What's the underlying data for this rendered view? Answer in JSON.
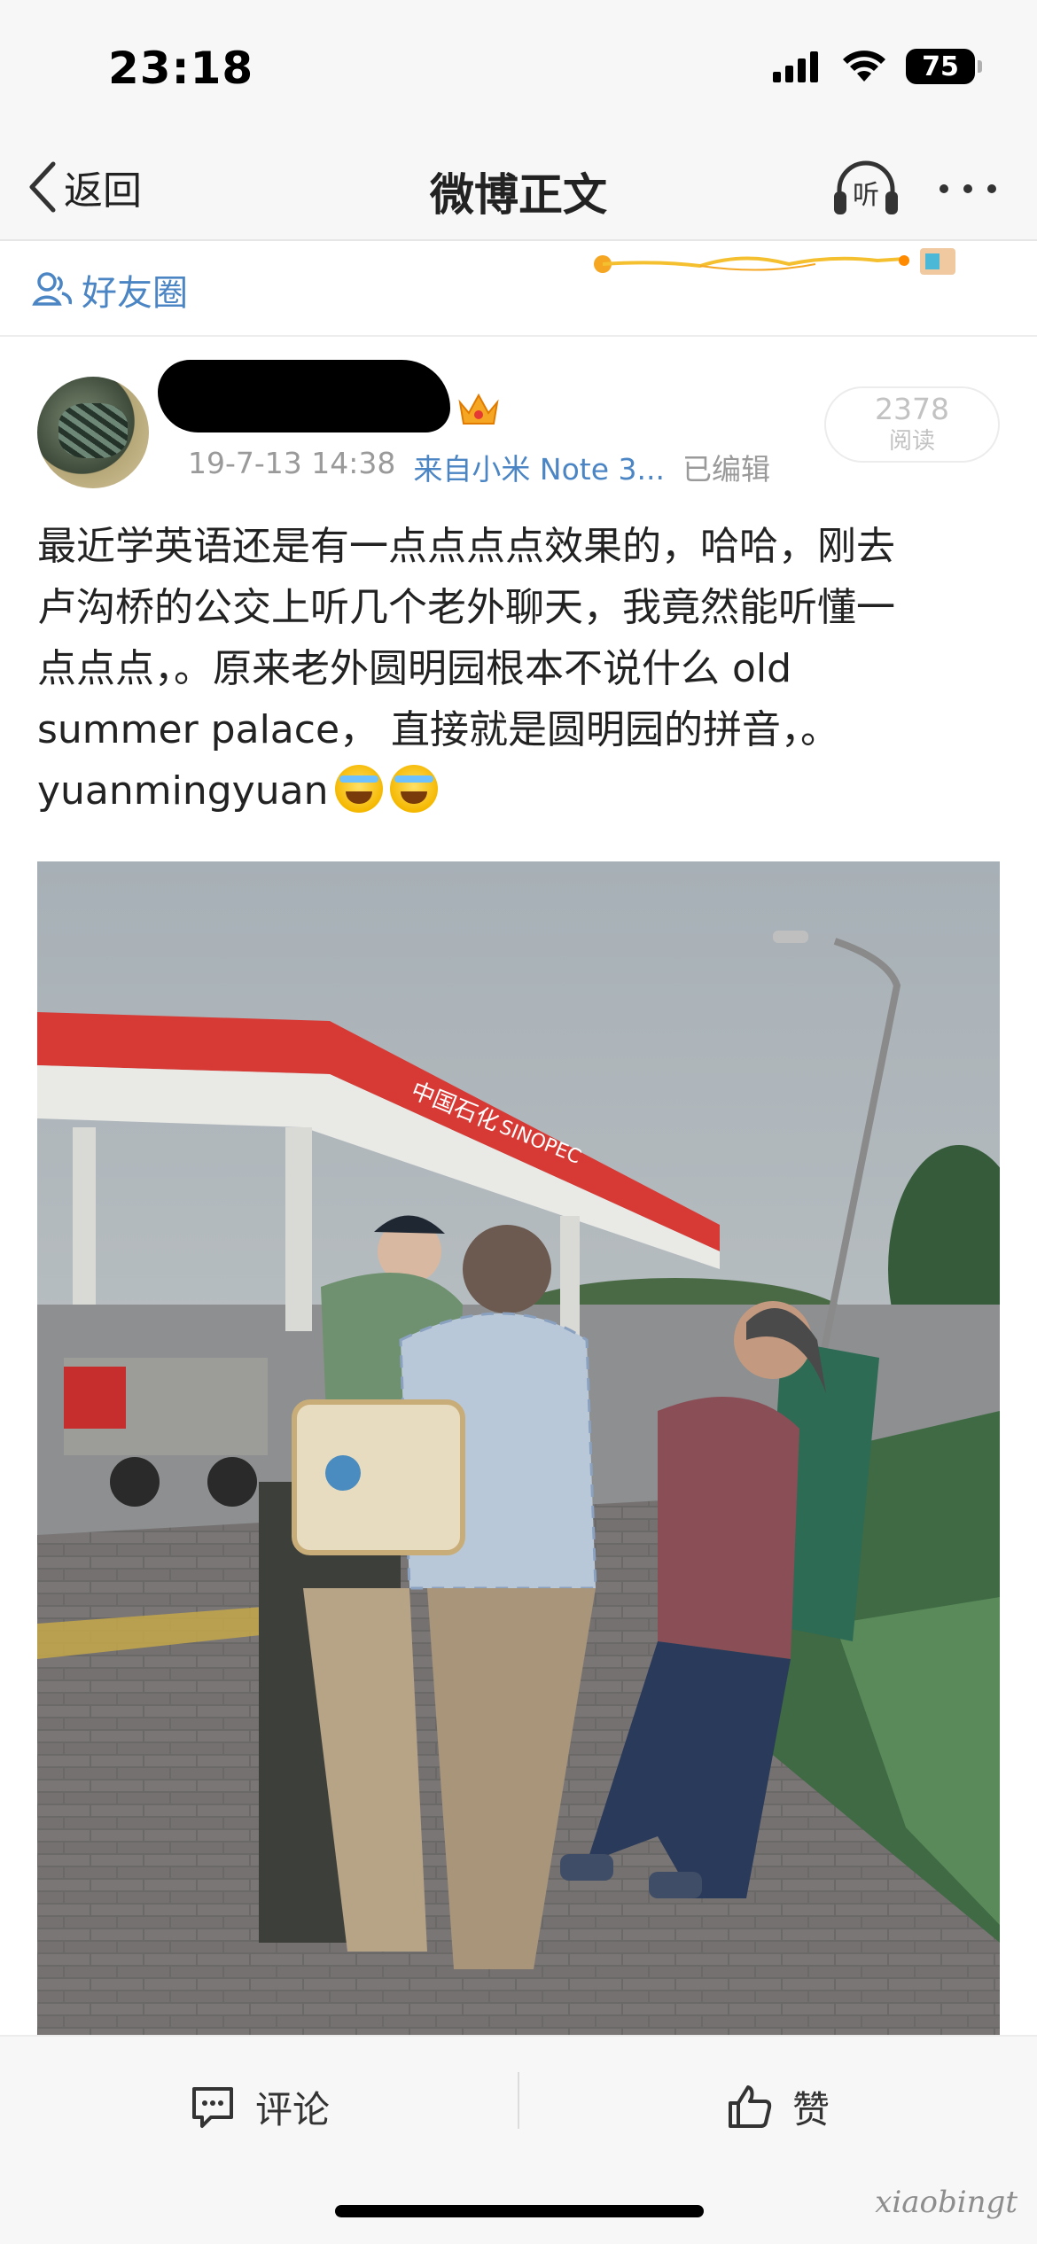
{
  "status_bar": {
    "time": "23:18",
    "battery": "75",
    "icons": [
      "signal-icon",
      "wifi-icon",
      "battery-icon"
    ]
  },
  "nav": {
    "back_label": "返回",
    "title": "微博正文",
    "listen_label": "听",
    "icons": [
      "chevron-left-icon",
      "headphones-icon",
      "more-dots-icon"
    ]
  },
  "visibility": {
    "label": "好友圈",
    "icon": "friends-circle-icon"
  },
  "post": {
    "meta": {
      "date": "19-7-13 14:38",
      "source": "来自小米 Note 3...",
      "edited": "已编辑"
    },
    "reads": {
      "count": "2378",
      "label": "阅读"
    },
    "text_lines": [
      "最近学英语还是有一点点点点效果的，哈哈，刚去",
      "卢沟桥的公交上听几个老外聊天，我竟然能听懂一",
      "点点点，。原来老外圆明园根本不说什么 old",
      "summer palace， 直接就是圆明园的拼音，。",
      "yuanmingyuan"
    ],
    "emoji": [
      "laugh-cry-emoji",
      "laugh-cry-emoji"
    ],
    "photo_signs": {
      "station_name": "中国石化",
      "station_brand": "SINOPEC"
    }
  },
  "actions": {
    "comment_label": "评论",
    "like_label": "赞"
  },
  "watermark": "xiaobingt",
  "colors": {
    "link_blue": "#4b85c4",
    "bar_bg": "#f7f7f7",
    "meta_gray": "#9a9a9a"
  }
}
